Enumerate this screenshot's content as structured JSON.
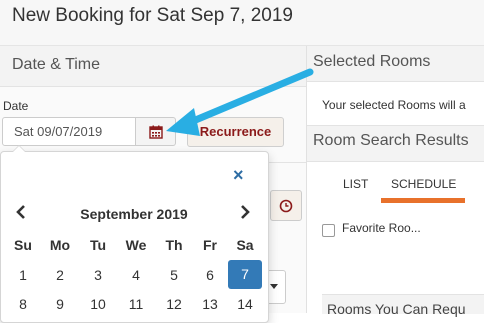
{
  "page": {
    "title": "New Booking for Sat Sep 7, 2019"
  },
  "left_panel": {
    "section_title": "Date & Time",
    "date_label": "Date",
    "date_value": "Sat 09/07/2019",
    "recurrence_label": "Recurrence"
  },
  "datepicker": {
    "close_icon": "×",
    "month_label": "September 2019",
    "weekdays": [
      "Su",
      "Mo",
      "Tu",
      "We",
      "Th",
      "Fr",
      "Sa"
    ],
    "row1": [
      "1",
      "2",
      "3",
      "4",
      "5",
      "6",
      "7"
    ],
    "row2": [
      "8",
      "9",
      "10",
      "11",
      "12",
      "13",
      "14"
    ],
    "selected_day": "7"
  },
  "right_panel": {
    "selected_rooms_title": "Selected Rooms",
    "selected_rooms_message": "Your selected Rooms will a",
    "search_results_title": "Room Search Results",
    "tabs": [
      "LIST",
      "SCHEDULE"
    ],
    "active_tab": "SCHEDULE",
    "favorite_label": "Favorite Roo...",
    "rooms_you_can_request": "Rooms You Can Requ"
  },
  "colors": {
    "accent": "#337ab7",
    "recurrence_text": "#8b1a1a",
    "tab_underline": "#e8712b",
    "annotation_arrow": "#29aee3"
  }
}
